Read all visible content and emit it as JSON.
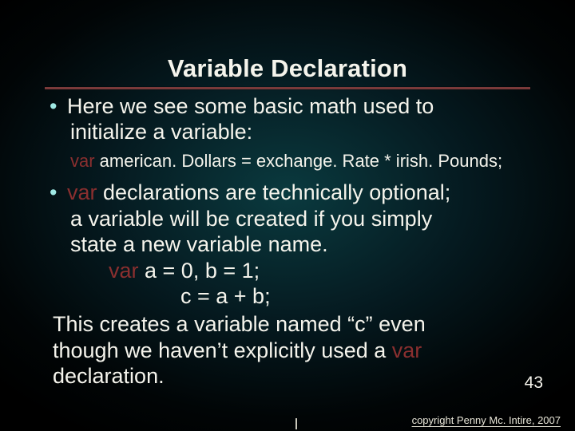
{
  "title": "Variable Declaration",
  "bullet1": {
    "line1": "Here we see some basic math used to",
    "line2": "initialize a variable:"
  },
  "code1": {
    "kw": "var",
    "rest": "  american. Dollars = exchange. Rate * irish. Pounds;"
  },
  "bullet2": {
    "p1a": "var",
    "p1b": " declarations are technically optional;",
    "p2": "a variable will be created if you simply",
    "p3": "state a new variable name.",
    "code_kw": "var",
    "code_l1_rest": "  a = 0, b = 1;",
    "code_l2": "c = a + b;",
    "p4": "This creates a variable named “c” even",
    "p5a": "though we haven’t explicitly used a ",
    "p5b": "var",
    "p6": "declaration."
  },
  "page_number": "43",
  "copyright": "copyright Penny Mc. Intire, 2007"
}
